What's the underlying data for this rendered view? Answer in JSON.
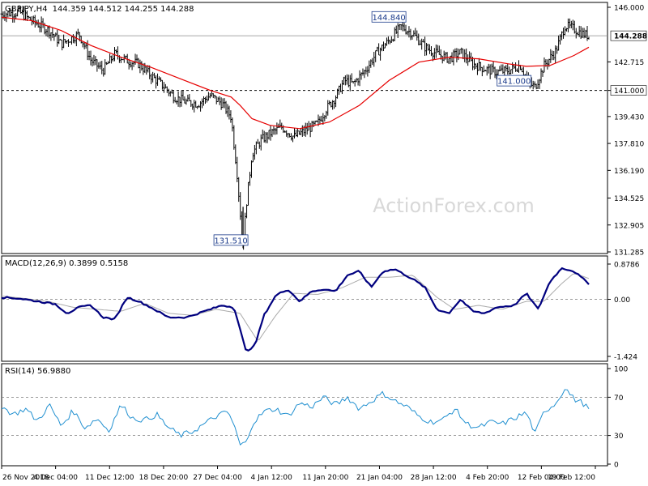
{
  "chart_data": {
    "type": "candlestick",
    "header": {
      "symbol": "GBPJPY,H4",
      "ohlc": "144.359 144.512 144.255 144.288"
    },
    "watermark": "ActionForex.com",
    "colors": {
      "background": "#ffffff",
      "candle": "#000000",
      "moving_average": "#e60000",
      "macd_line": "#00007f",
      "signal_line": "#aaaaaa",
      "rsi_line": "#1f8fd0",
      "grid": "#777777",
      "watermark": "#d8d8d8"
    },
    "x_labels": [
      "26 Nov 2018",
      "4 Dec 04:00",
      "11 Dec 12:00",
      "18 Dec 20:00",
      "27 Dec 04:00",
      "4 Jan 12:00",
      "11 Jan 20:00",
      "21 Jan 04:00",
      "28 Jan 12:00",
      "4 Feb 20:00",
      "12 Feb 04:00",
      "19 Feb 12:00"
    ],
    "price": {
      "ylim": [
        131.285,
        146.0
      ],
      "ticks": [
        "146.000",
        "142.715",
        "141.000",
        "139.430",
        "137.810",
        "136.190",
        "134.525",
        "132.905",
        "131.285"
      ],
      "ticks_num": [
        146.0,
        142.715,
        141.0,
        139.43,
        137.81,
        136.19,
        134.525,
        132.905,
        131.285
      ],
      "last_price": 144.288,
      "last_price_label": "144.288",
      "support": 141.0,
      "support_label": "141.000",
      "annotations": [
        {
          "text": "144.840",
          "value": 144.84,
          "x_frac": 0.67
        },
        {
          "text": "141.000",
          "value": 141.0,
          "x_frac": 0.88
        },
        {
          "text": "131.510",
          "value": 131.51,
          "x_frac": 0.405
        }
      ],
      "path": [
        [
          0.0,
          145.6
        ],
        [
          0.03,
          145.7
        ],
        [
          0.05,
          145.2
        ],
        [
          0.08,
          144.6
        ],
        [
          0.1,
          143.8
        ],
        [
          0.13,
          144.4
        ],
        [
          0.15,
          142.8
        ],
        [
          0.17,
          142.2
        ],
        [
          0.19,
          143.2
        ],
        [
          0.21,
          142.8
        ],
        [
          0.23,
          142.6
        ],
        [
          0.25,
          141.9
        ],
        [
          0.27,
          141.3
        ],
        [
          0.29,
          140.6
        ],
        [
          0.31,
          140.3
        ],
        [
          0.33,
          140.2
        ],
        [
          0.35,
          140.7
        ],
        [
          0.37,
          140.2
        ],
        [
          0.385,
          139.4
        ],
        [
          0.395,
          136.0
        ],
        [
          0.405,
          131.51
        ],
        [
          0.41,
          134.0
        ],
        [
          0.42,
          137.2
        ],
        [
          0.435,
          138.0
        ],
        [
          0.45,
          138.4
        ],
        [
          0.47,
          138.8
        ],
        [
          0.49,
          138.2
        ],
        [
          0.51,
          138.6
        ],
        [
          0.53,
          139.0
        ],
        [
          0.545,
          139.9
        ],
        [
          0.56,
          140.6
        ],
        [
          0.575,
          141.6
        ],
        [
          0.59,
          141.4
        ],
        [
          0.61,
          142.2
        ],
        [
          0.63,
          143.3
        ],
        [
          0.65,
          144.0
        ],
        [
          0.67,
          144.84
        ],
        [
          0.69,
          144.4
        ],
        [
          0.71,
          143.6
        ],
        [
          0.73,
          143.2
        ],
        [
          0.75,
          142.9
        ],
        [
          0.77,
          143.3
        ],
        [
          0.79,
          142.6
        ],
        [
          0.81,
          142.3
        ],
        [
          0.83,
          142.1
        ],
        [
          0.85,
          142.2
        ],
        [
          0.87,
          142.5
        ],
        [
          0.885,
          141.4
        ],
        [
          0.895,
          141.2
        ],
        [
          0.91,
          142.5
        ],
        [
          0.93,
          143.4
        ],
        [
          0.945,
          144.9
        ],
        [
          0.96,
          144.7
        ],
        [
          0.975,
          144.4
        ],
        [
          0.985,
          144.288
        ]
      ],
      "ma_path": [
        [
          0.0,
          145.4
        ],
        [
          0.05,
          145.2
        ],
        [
          0.1,
          144.6
        ],
        [
          0.15,
          143.7
        ],
        [
          0.2,
          143.0
        ],
        [
          0.25,
          142.4
        ],
        [
          0.3,
          141.7
        ],
        [
          0.35,
          141.0
        ],
        [
          0.385,
          140.6
        ],
        [
          0.4,
          140.1
        ],
        [
          0.42,
          139.3
        ],
        [
          0.45,
          138.9
        ],
        [
          0.5,
          138.7
        ],
        [
          0.55,
          139.1
        ],
        [
          0.6,
          140.1
        ],
        [
          0.65,
          141.6
        ],
        [
          0.7,
          142.7
        ],
        [
          0.75,
          143.0
        ],
        [
          0.8,
          142.9
        ],
        [
          0.85,
          142.6
        ],
        [
          0.88,
          142.45
        ],
        [
          0.92,
          142.5
        ],
        [
          0.96,
          143.1
        ],
        [
          0.985,
          143.6
        ]
      ]
    },
    "macd": {
      "label": "MACD(12,26,9) 0.3899 0.5158",
      "ylim": [
        -1.424,
        0.8786
      ],
      "ticks": [
        "0.8786",
        "0.00",
        "-1.424"
      ],
      "ticks_num": [
        0.8786,
        0.0,
        -1.424
      ],
      "macd_path": [
        [
          0.0,
          0.05
        ],
        [
          0.03,
          0.02
        ],
        [
          0.06,
          -0.05
        ],
        [
          0.09,
          -0.12
        ],
        [
          0.11,
          -0.35
        ],
        [
          0.13,
          -0.2
        ],
        [
          0.15,
          -0.15
        ],
        [
          0.17,
          -0.45
        ],
        [
          0.19,
          -0.5
        ],
        [
          0.21,
          0.05
        ],
        [
          0.23,
          -0.05
        ],
        [
          0.25,
          -0.2
        ],
        [
          0.28,
          -0.45
        ],
        [
          0.31,
          -0.45
        ],
        [
          0.34,
          -0.3
        ],
        [
          0.37,
          -0.15
        ],
        [
          0.39,
          -0.2
        ],
        [
          0.41,
          -1.3
        ],
        [
          0.425,
          -1.15
        ],
        [
          0.44,
          -0.4
        ],
        [
          0.46,
          0.1
        ],
        [
          0.48,
          0.25
        ],
        [
          0.5,
          -0.05
        ],
        [
          0.52,
          0.2
        ],
        [
          0.54,
          0.25
        ],
        [
          0.56,
          0.2
        ],
        [
          0.58,
          0.6
        ],
        [
          0.6,
          0.7
        ],
        [
          0.62,
          0.3
        ],
        [
          0.64,
          0.7
        ],
        [
          0.66,
          0.75
        ],
        [
          0.69,
          0.5
        ],
        [
          0.71,
          0.3
        ],
        [
          0.73,
          -0.25
        ],
        [
          0.75,
          -0.35
        ],
        [
          0.77,
          0.0
        ],
        [
          0.79,
          -0.3
        ],
        [
          0.81,
          -0.35
        ],
        [
          0.83,
          -0.2
        ],
        [
          0.86,
          -0.15
        ],
        [
          0.88,
          0.15
        ],
        [
          0.9,
          -0.25
        ],
        [
          0.92,
          0.45
        ],
        [
          0.94,
          0.78
        ],
        [
          0.96,
          0.7
        ],
        [
          0.985,
          0.39
        ]
      ],
      "signal_path": [
        [
          0.0,
          0.08
        ],
        [
          0.04,
          0.02
        ],
        [
          0.08,
          -0.06
        ],
        [
          0.12,
          -0.2
        ],
        [
          0.16,
          -0.25
        ],
        [
          0.2,
          -0.3
        ],
        [
          0.24,
          -0.1
        ],
        [
          0.28,
          -0.35
        ],
        [
          0.32,
          -0.4
        ],
        [
          0.36,
          -0.25
        ],
        [
          0.4,
          -0.35
        ],
        [
          0.43,
          -1.05
        ],
        [
          0.46,
          -0.4
        ],
        [
          0.49,
          0.15
        ],
        [
          0.53,
          0.12
        ],
        [
          0.57,
          0.28
        ],
        [
          0.61,
          0.55
        ],
        [
          0.65,
          0.55
        ],
        [
          0.69,
          0.6
        ],
        [
          0.73,
          0.05
        ],
        [
          0.76,
          -0.25
        ],
        [
          0.8,
          -0.15
        ],
        [
          0.84,
          -0.25
        ],
        [
          0.88,
          -0.05
        ],
        [
          0.91,
          -0.05
        ],
        [
          0.94,
          0.4
        ],
        [
          0.96,
          0.65
        ],
        [
          0.985,
          0.52
        ]
      ]
    },
    "rsi": {
      "label": "RSI(14) 56.9880",
      "ylim": [
        0,
        100
      ],
      "ticks": [
        "100",
        "70",
        "30",
        "0"
      ],
      "ticks_num": [
        100,
        70,
        30,
        0
      ],
      "levels": [
        70,
        30
      ],
      "path": [
        [
          0.0,
          60
        ],
        [
          0.02,
          52
        ],
        [
          0.04,
          58
        ],
        [
          0.06,
          45
        ],
        [
          0.08,
          62
        ],
        [
          0.1,
          40
        ],
        [
          0.12,
          56
        ],
        [
          0.14,
          38
        ],
        [
          0.16,
          48
        ],
        [
          0.18,
          35
        ],
        [
          0.2,
          62
        ],
        [
          0.22,
          48
        ],
        [
          0.24,
          46
        ],
        [
          0.26,
          52
        ],
        [
          0.28,
          38
        ],
        [
          0.3,
          30
        ],
        [
          0.32,
          34
        ],
        [
          0.34,
          42
        ],
        [
          0.36,
          50
        ],
        [
          0.38,
          55
        ],
        [
          0.39,
          40
        ],
        [
          0.4,
          20
        ],
        [
          0.41,
          22
        ],
        [
          0.42,
          42
        ],
        [
          0.44,
          55
        ],
        [
          0.46,
          58
        ],
        [
          0.48,
          50
        ],
        [
          0.5,
          64
        ],
        [
          0.52,
          60
        ],
        [
          0.54,
          70
        ],
        [
          0.56,
          62
        ],
        [
          0.58,
          70
        ],
        [
          0.6,
          58
        ],
        [
          0.62,
          66
        ],
        [
          0.64,
          74
        ],
        [
          0.66,
          66
        ],
        [
          0.68,
          60
        ],
        [
          0.7,
          50
        ],
        [
          0.72,
          44
        ],
        [
          0.74,
          46
        ],
        [
          0.76,
          58
        ],
        [
          0.78,
          42
        ],
        [
          0.8,
          38
        ],
        [
          0.82,
          44
        ],
        [
          0.84,
          42
        ],
        [
          0.86,
          48
        ],
        [
          0.88,
          54
        ],
        [
          0.895,
          32
        ],
        [
          0.91,
          55
        ],
        [
          0.93,
          64
        ],
        [
          0.945,
          80
        ],
        [
          0.96,
          68
        ],
        [
          0.975,
          64
        ],
        [
          0.985,
          57
        ]
      ]
    }
  }
}
